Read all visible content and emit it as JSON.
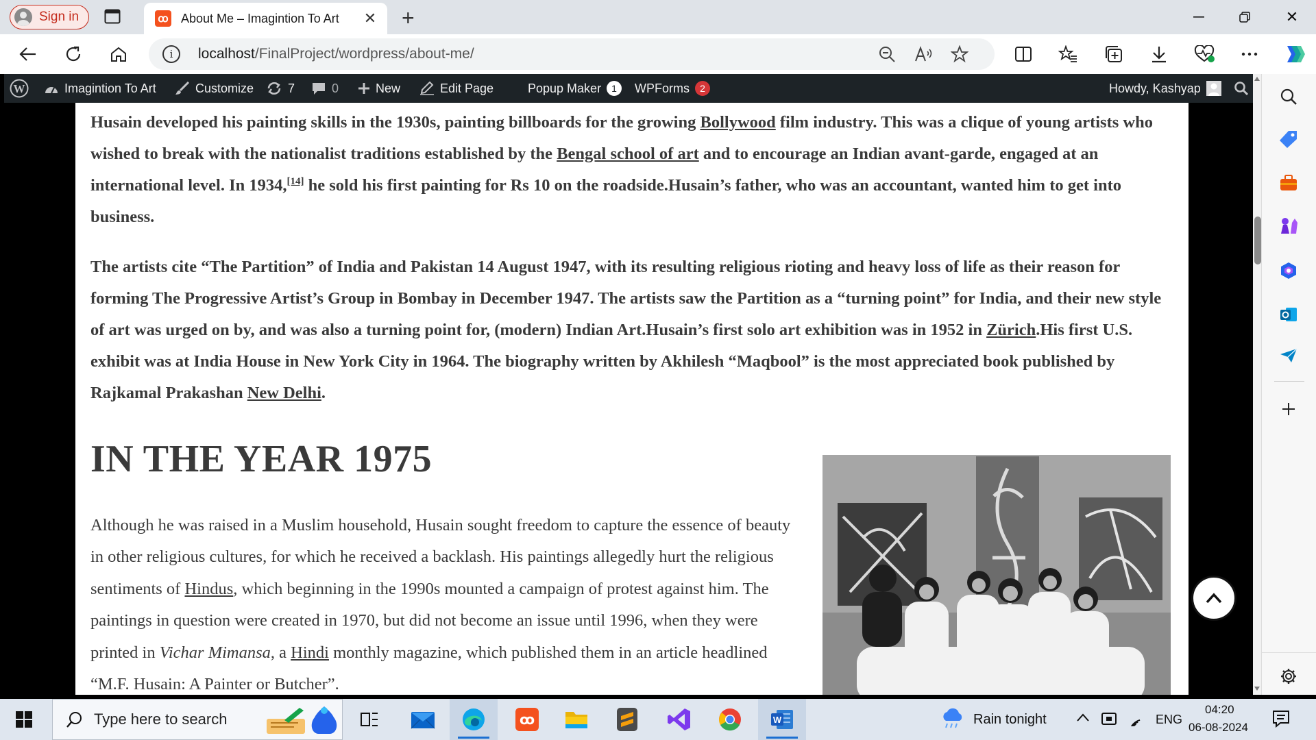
{
  "browser": {
    "signin_label": "Sign in",
    "tab_title": "About Me – Imagintion To Art",
    "favicon_glyph": "ꝏ",
    "url_host": "localhost",
    "url_path": "/FinalProject/wordpress/about-me/"
  },
  "adminbar": {
    "site_name": "Imagintion To Art",
    "customize": "Customize",
    "updates_count": "7",
    "comments_count": "0",
    "new_label": "New",
    "edit_page": "Edit Page",
    "popup_maker": "Popup Maker",
    "popup_maker_badge": "1",
    "wpforms": "WPForms",
    "wpforms_badge": "2",
    "howdy": "Howdy, Kashyap"
  },
  "article": {
    "p1": {
      "t1": "Husain developed his painting skills in the 1930s, painting billboards for the growing ",
      "link1": "Bollywood",
      "t2": " film industry. This was a clique of young artists who wished to break with the nationalist traditions established by the ",
      "link2": "Bengal school of art",
      "t3": " and to encourage an Indian avant-garde, engaged at an international level. In 1934,",
      "sup": "[14]",
      "t4": " he sold his first painting for Rs 10 on the roadside.Husain’s father, who was an accountant, wanted him to get into business."
    },
    "p2": {
      "t1": "The artists cite “The Partition” of India and Pakistan 14 August 1947, with its resulting religious rioting and heavy loss of life as their reason for forming The Progressive Artist’s Group in Bombay in December 1947. The artists saw the Partition as a “turning point” for India, and their new style of art was urged on by, and was also a turning point for, (modern) Indian Art.Husain’s first solo art exhibition was in 1952 in ",
      "link1": "Zürich",
      "t2": ".His first U.S. exhibit was at India House in New York City in 1964. The biography written by Akhilesh “Maqbool” is the most appreciated book published by Rajkamal Prakashan ",
      "link2": "New Delhi",
      "t3": "."
    },
    "heading": "IN THE YEAR 1975",
    "p3": {
      "t1": "Although he was raised in a Muslim household, Husain sought freedom to capture the essence of beauty in other religious cultures, for which he received a backlash. His paintings allegedly hurt the religious sentiments of ",
      "link1": "Hindus",
      "t2": ", which beginning in the 1990s mounted a campaign of protest against him. The paintings in question were created in 1970, but did not become an issue until 1996, when they were printed in ",
      "em": "Vichar Mimansa",
      "t3": ", a ",
      "link2": "Hindi",
      "t4": " monthly magazine, which published them in an article headlined “M.F. Husain: A Painter or Butcher”."
    }
  },
  "taskbar": {
    "search_placeholder": "Type here to search",
    "weather": "Rain tonight",
    "language": "ENG",
    "time": "04:20",
    "date": "06-08-2024"
  }
}
